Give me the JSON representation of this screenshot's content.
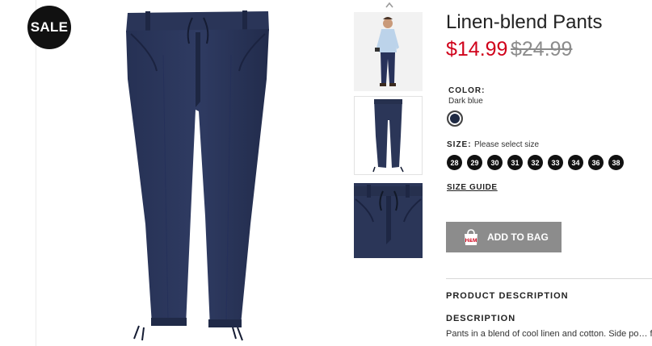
{
  "badge": {
    "label": "SALE"
  },
  "product": {
    "title": "Linen-blend Pants",
    "price_sale": "$14.99",
    "price_original": "$24.99"
  },
  "color": {
    "label": "COLOR:",
    "value": "Dark blue",
    "swatch_hex": "#1f2a44"
  },
  "size": {
    "label": "SIZE:",
    "hint": "Please select size",
    "options": [
      "28",
      "29",
      "30",
      "31",
      "32",
      "33",
      "34",
      "36",
      "38"
    ],
    "guide_label": "SIZE GUIDE"
  },
  "actions": {
    "add_to_bag": "ADD TO BAG",
    "bag_icon": "hm-shopping-bag-icon",
    "thumb_scroll_icon": "chevron-up-icon"
  },
  "description": {
    "section_title": "PRODUCT DESCRIPTION",
    "heading": "DESCRIPTION",
    "text": "Pants in a blend of cool linen and cotton. Side po… flap and button, and drawstring at waist and at h…"
  },
  "colors": {
    "sale_price": "#d0021b",
    "old_price": "#8c8c8c",
    "button_bg": "#8c8c8c",
    "badge_bg": "#111111"
  }
}
